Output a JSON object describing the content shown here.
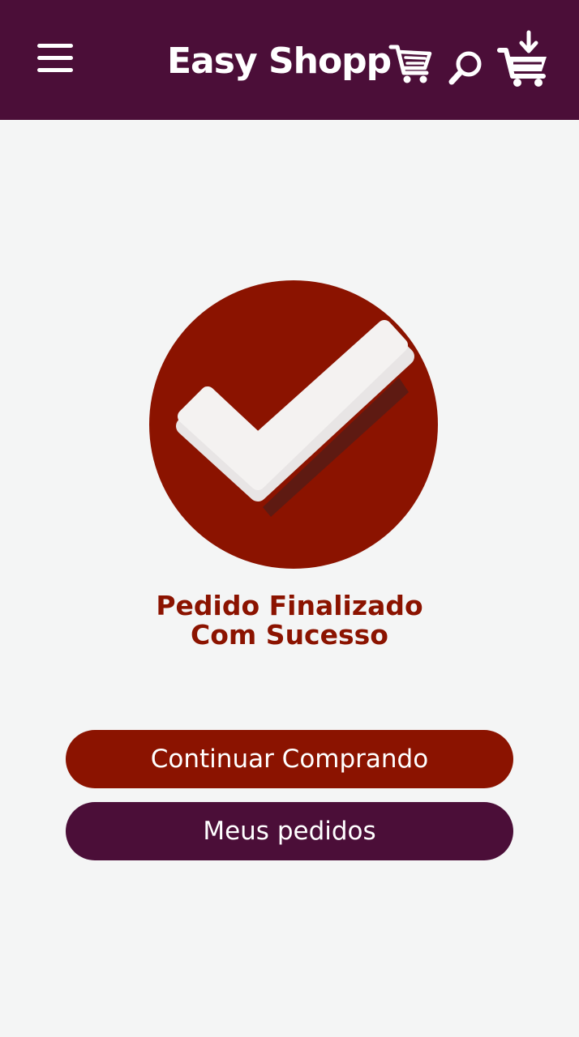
{
  "header": {
    "logo_text": "Easy Shopp",
    "background_color": "#4b0e38",
    "icons": {
      "menu": "hamburger-menu-icon",
      "logo_cart": "shopping-cart-icon",
      "search": "search-icon",
      "cart": "cart-download-icon"
    }
  },
  "main": {
    "success_icon": "check-circle-icon",
    "success_line1": "Pedido Finalizado",
    "success_line2": "Com Sucesso",
    "accent_color": "#8b1300"
  },
  "actions": {
    "continue_label": "Continuar Comprando",
    "orders_label": "Meus pedidos"
  }
}
